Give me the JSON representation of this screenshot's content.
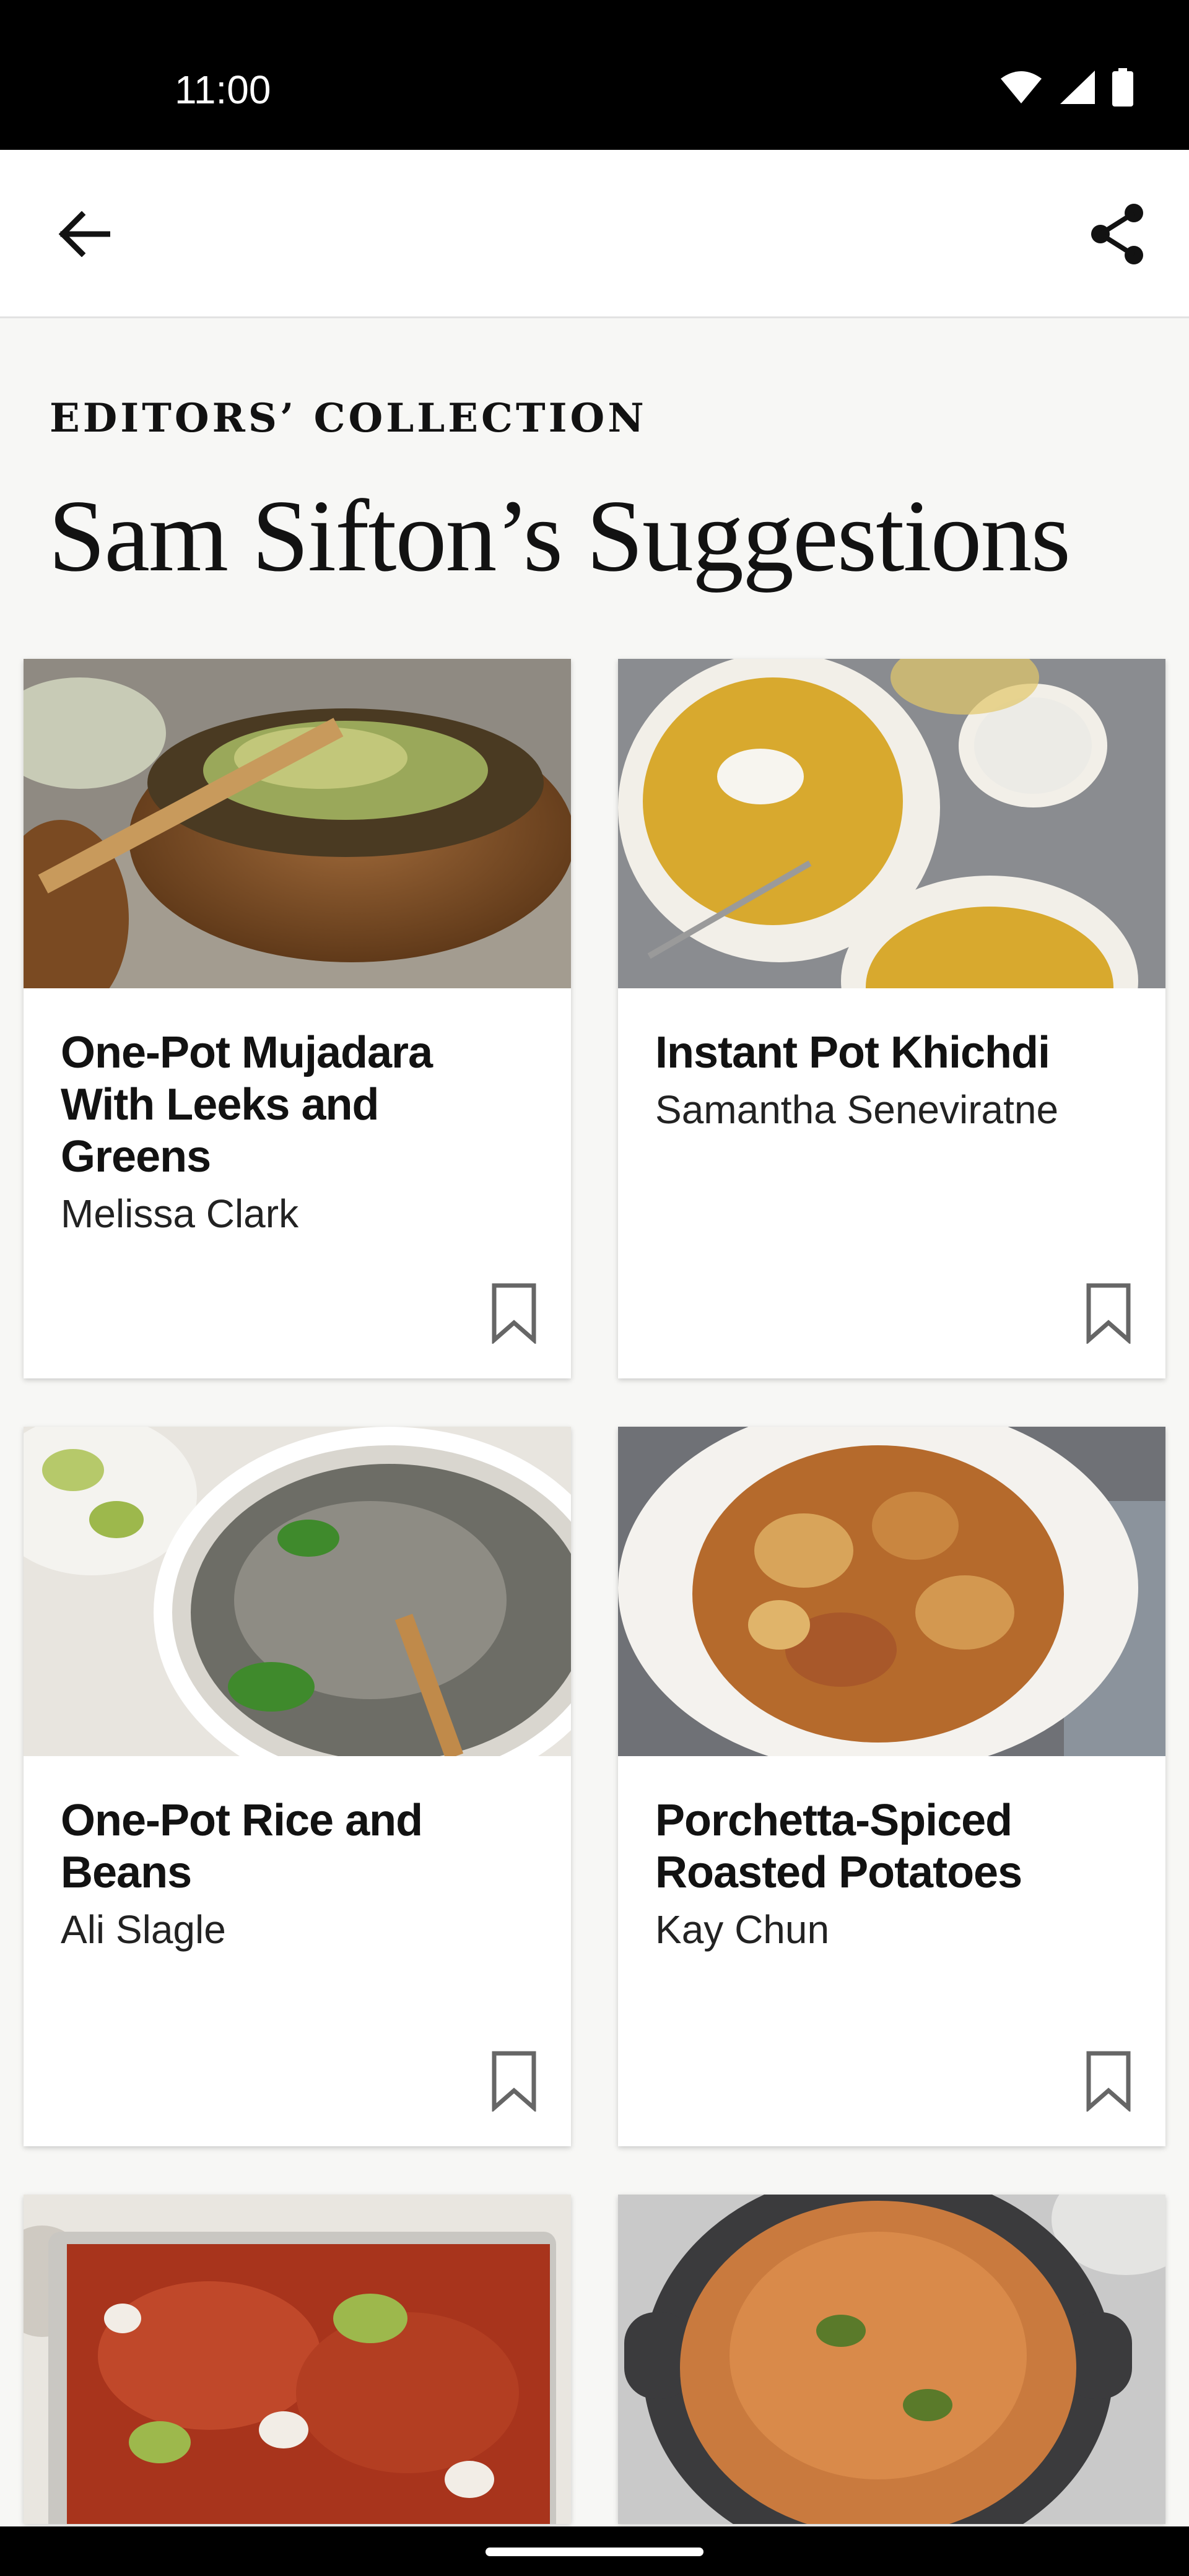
{
  "status": {
    "time": "11:00"
  },
  "header": {
    "eyebrow": "EDITORS’ COLLECTION",
    "title": "Sam Sifton’s Suggestions"
  },
  "recipes": [
    {
      "title": "One-Pot Mujadara With Leeks and Greens",
      "author": "Melissa Clark"
    },
    {
      "title": "Instant Pot Khichdi",
      "author": "Samantha Seneviratne"
    },
    {
      "title": "One-Pot Rice and Beans",
      "author": "Ali Slagle"
    },
    {
      "title": "Porchetta-Spiced Roasted Potatoes",
      "author": "Kay Chun"
    }
  ],
  "icons": {
    "back": "arrow-left-icon",
    "share": "share-icon",
    "save": "bookmark-icon"
  },
  "colors": {
    "text": "#121212",
    "background": "#f7f7f5",
    "card": "#ffffff"
  }
}
